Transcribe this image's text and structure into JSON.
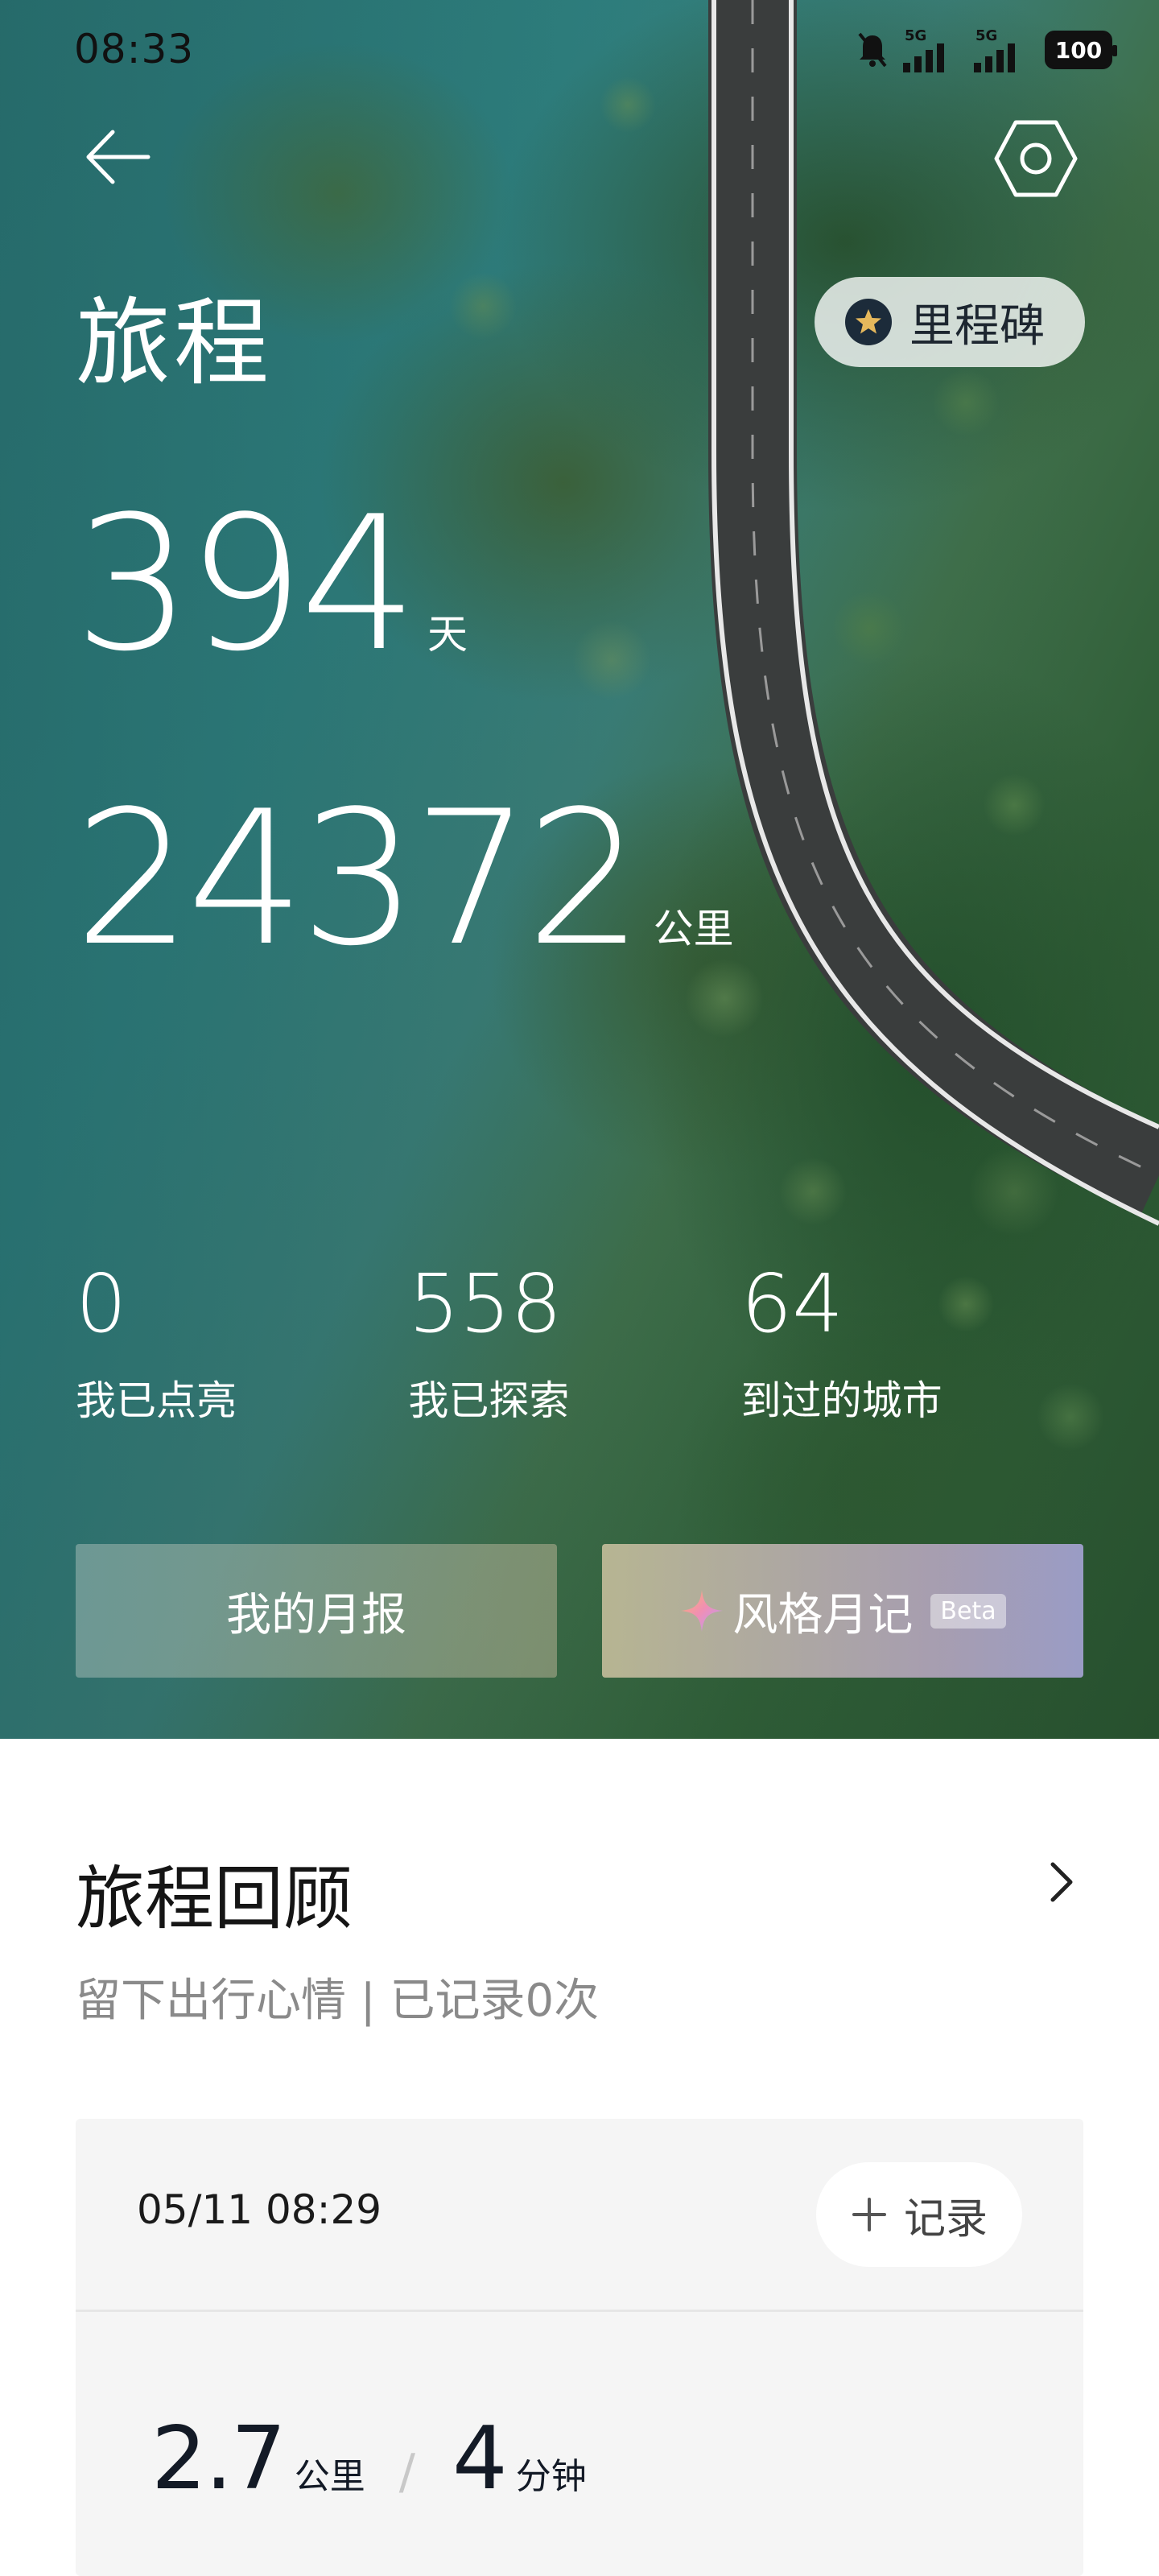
{
  "status_bar": {
    "time": "08:33",
    "network_1": "5G",
    "network_2": "5G",
    "battery": "100"
  },
  "header": {
    "title": "旅程",
    "milestone_label": "里程碑"
  },
  "stats": {
    "days": {
      "value": "394",
      "unit": "天"
    },
    "distance": {
      "value": "24372",
      "unit": "公里"
    },
    "lit": {
      "value": "0",
      "label": "我已点亮"
    },
    "explored": {
      "value": "558",
      "label": "我已探索"
    },
    "cities": {
      "value": "64",
      "label": "到过的城市"
    }
  },
  "buttons": {
    "monthly_report": "我的月报",
    "style_diary": "风格月记",
    "beta": "Beta"
  },
  "review": {
    "title": "旅程回顾",
    "subtitle": "留下出行心情 | 已记录0次",
    "card": {
      "datetime": "05/11 08:29",
      "record_label": "记录",
      "distance_value": "2.7",
      "distance_unit": "公里",
      "duration_value": "4",
      "duration_unit": "分钟"
    }
  },
  "icons": {
    "back": "arrow-left-icon",
    "settings": "hexagon-settings-icon",
    "milestone": "star-icon",
    "sparkle": "sparkle-icon",
    "chevron": "chevron-right-icon",
    "plus": "plus-icon"
  },
  "colors": {
    "water": "#2f8180",
    "forest": "#2f5d36",
    "star_badge": "#1c2b3a",
    "text_primary": "#151515",
    "text_secondary": "#8a8a8a"
  }
}
